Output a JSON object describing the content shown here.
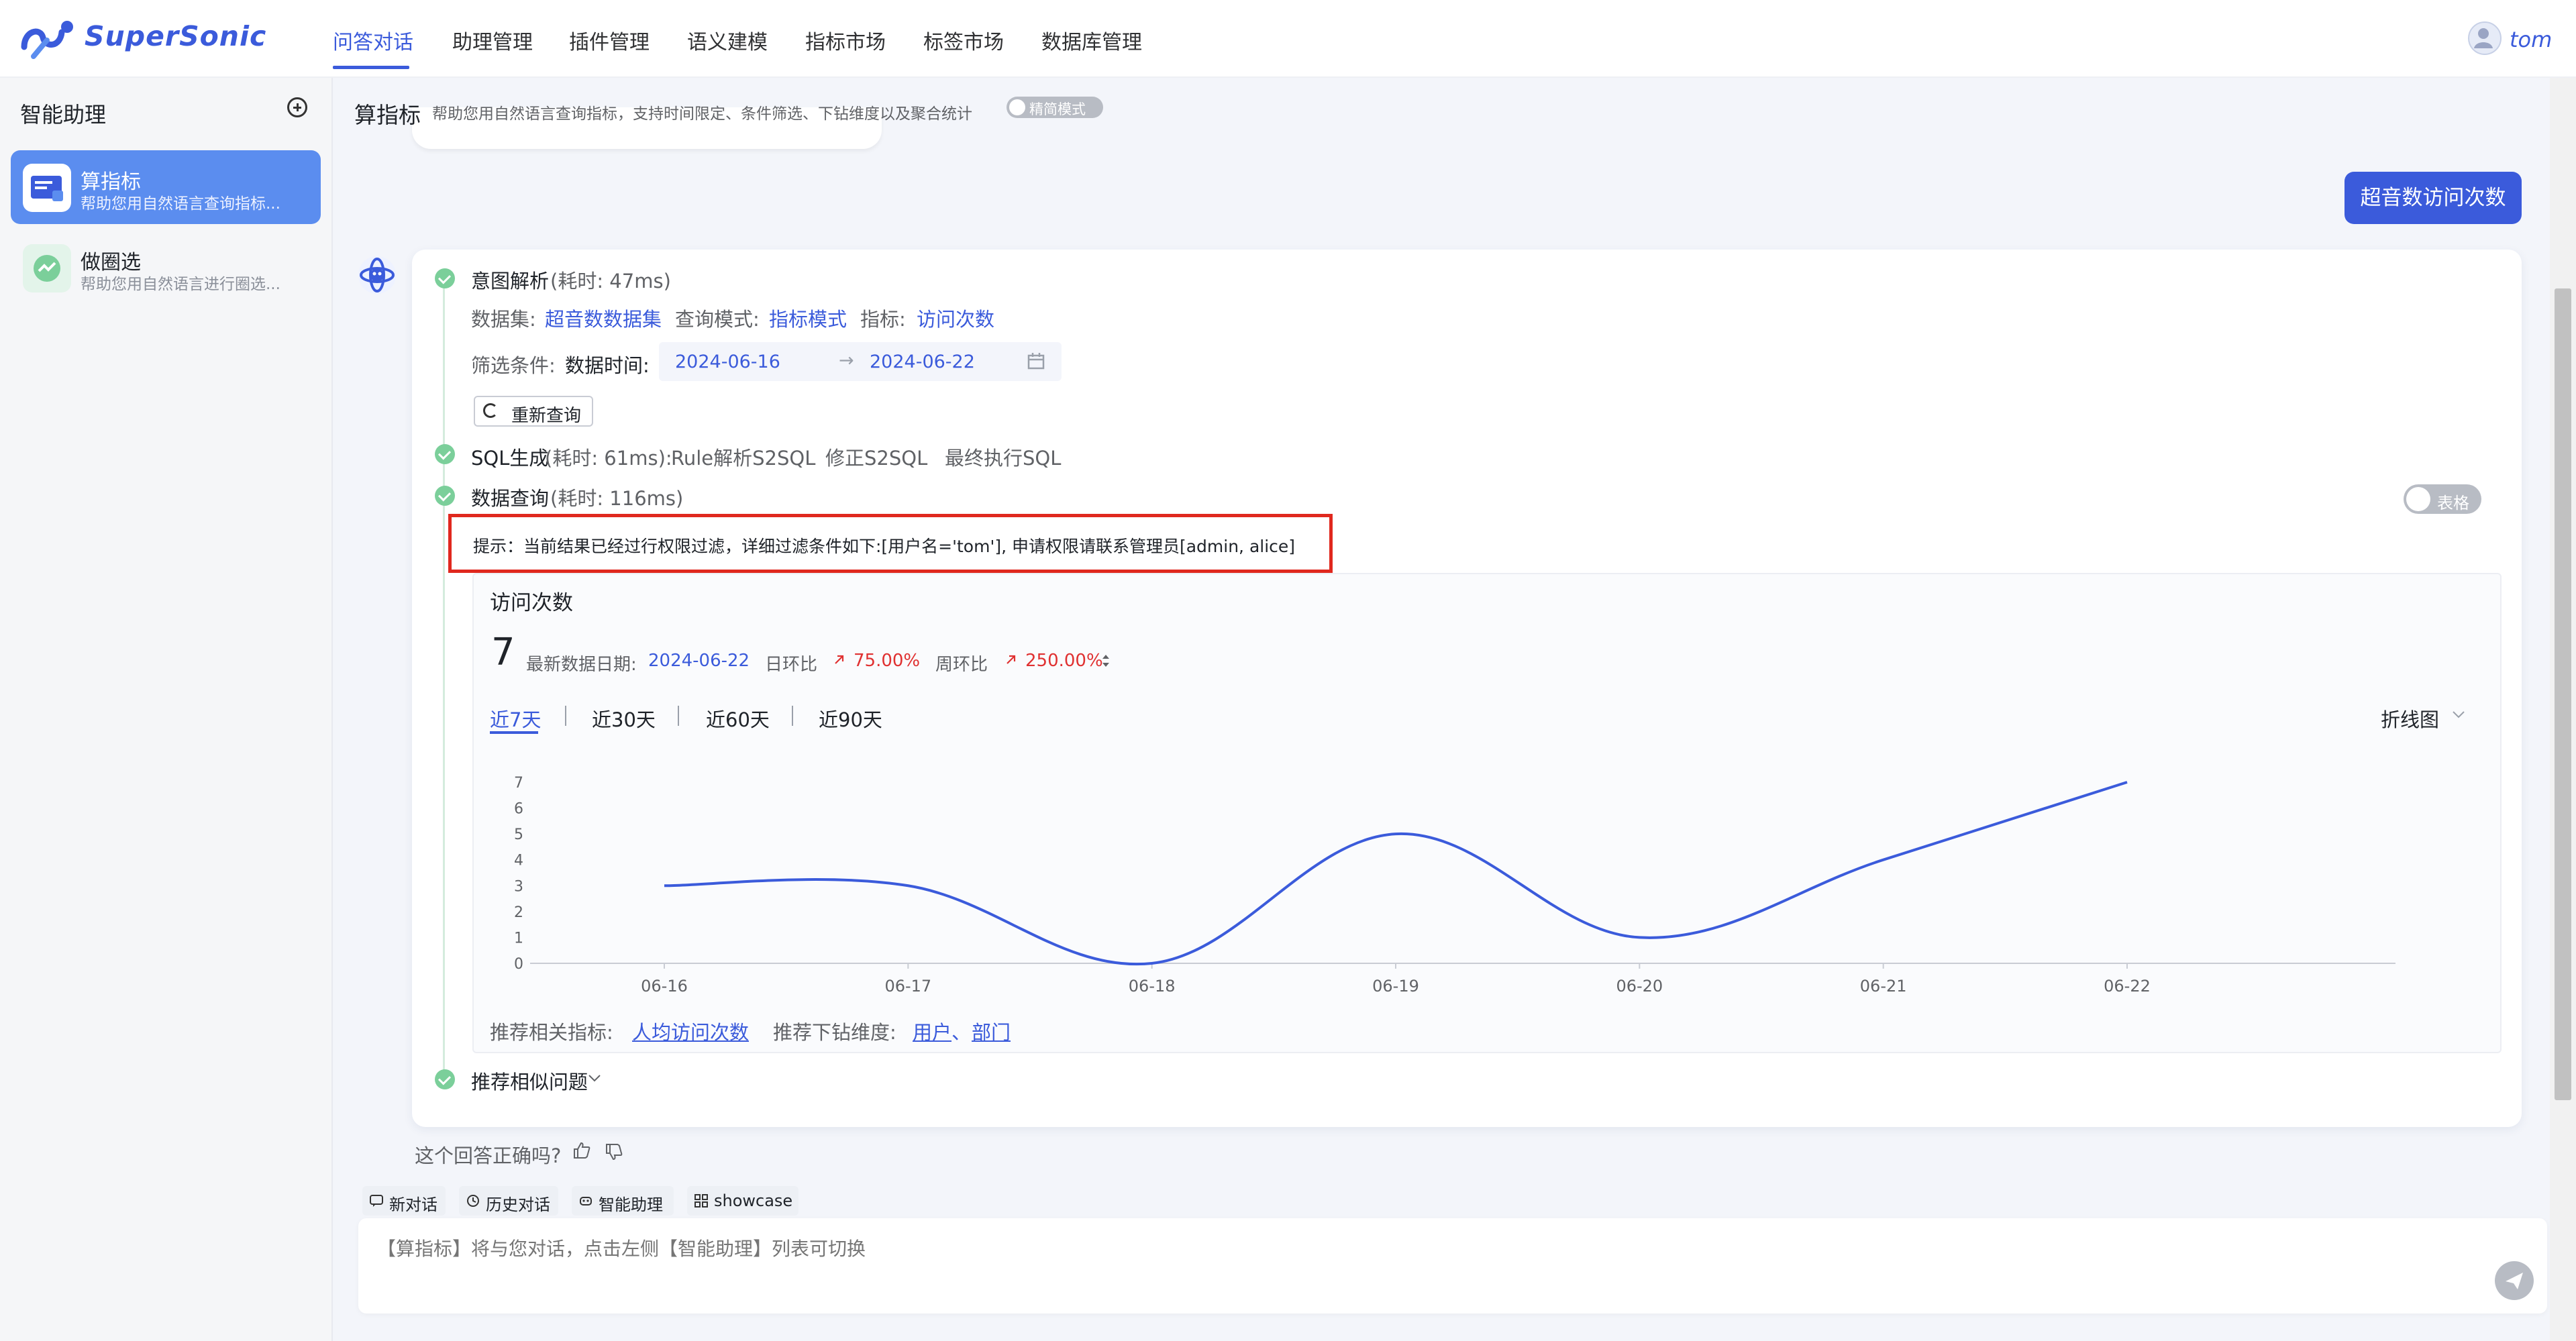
{
  "app": {
    "name": "SuperSonic",
    "user": "tom"
  },
  "nav": [
    {
      "label": "问答对话",
      "active": true
    },
    {
      "label": "助理管理"
    },
    {
      "label": "插件管理"
    },
    {
      "label": "语义建模"
    },
    {
      "label": "指标市场"
    },
    {
      "label": "标签市场"
    },
    {
      "label": "数据库管理"
    }
  ],
  "sidebar": {
    "title": "智能助理",
    "agents": [
      {
        "name": "算指标",
        "desc": "帮助您用自然语言查询指标...",
        "active": true
      },
      {
        "name": "做圈选",
        "desc": "帮助您用自然语言进行圈选..."
      }
    ]
  },
  "header": {
    "agent_name": "算指标",
    "desc": "帮助您用自然语言查询指标，支持时间限定、条件筛选、下钻维度以及聚合统计",
    "mode_label": "精简模式"
  },
  "question": "超音数访问次数",
  "answer": {
    "intent": {
      "title": "意图解析",
      "time": "(耗时: 47ms)",
      "dataset_label": "数据集:",
      "dataset": "超音数数据集",
      "mode_label": "查询模式:",
      "mode": "指标模式",
      "metric_label": "指标:",
      "metric": "访问次数",
      "filter_label": "筛选条件:",
      "date_label": "数据时间:",
      "date_start": "2024-06-16",
      "date_end": "2024-06-22",
      "date_sep": "→",
      "requery": "重新查询"
    },
    "sql": {
      "title": "SQL生成",
      "time": "(耗时: 61ms):",
      "links": [
        "Rule解析S2SQL",
        "修正S2SQL",
        "最终执行SQL"
      ]
    },
    "data": {
      "title": "数据查询",
      "time": "(耗时: 116ms)",
      "table_toggle": "表格",
      "hint": "提示：当前结果已经过行权限过滤，详细过滤条件如下:[用户名='tom'], 申请权限请联系管理员[admin, alice]"
    },
    "metric_card": {
      "name": "访问次数",
      "value": "7",
      "latest_label": "最新数据日期:",
      "latest_date": "2024-06-22",
      "day_label": "日环比",
      "day_value": "75.00%",
      "week_label": "周环比",
      "week_value": "250.00%",
      "ranges": [
        "近7天",
        "近30天",
        "近60天",
        "近90天"
      ],
      "chart_type": "折线图",
      "rec_metric_label": "推荐相关指标:",
      "rec_metric": "人均访问次数",
      "rec_dim_label": "推荐下钻维度:",
      "rec_dims": [
        "用户",
        "部门"
      ],
      "rec_dim_sep": "、"
    },
    "similar": "推荐相似问题"
  },
  "chart_data": {
    "type": "line",
    "x": [
      "06-16",
      "06-17",
      "06-18",
      "06-19",
      "06-20",
      "06-21",
      "06-22"
    ],
    "series": [
      {
        "values": [
          3,
          3,
          0,
          5,
          1,
          4,
          7
        ]
      }
    ],
    "ylim": [
      0,
      7
    ],
    "yticks": [
      "0",
      "1",
      "2",
      "3",
      "4",
      "5",
      "6",
      "7"
    ],
    "color": "#3b5bdb",
    "grid": false
  },
  "feedback": "这个回答正确吗?",
  "bottom": {
    "buttons": [
      "新对话",
      "历史对话",
      "智能助理",
      "showcase"
    ],
    "placeholder": "【算指标】将与您对话，点击左侧【智能助理】列表可切换"
  }
}
